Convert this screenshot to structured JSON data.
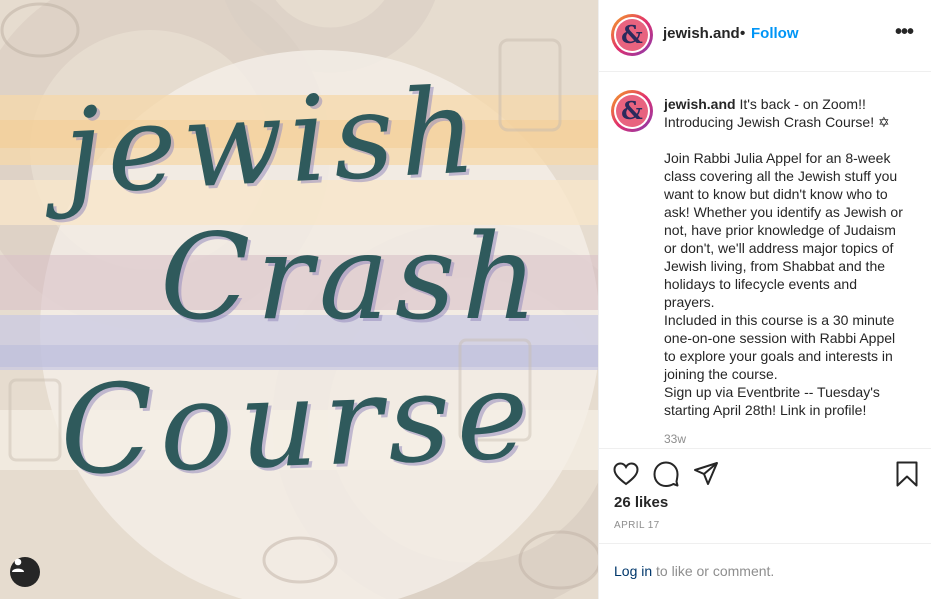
{
  "post": {
    "image": {
      "lettering": [
        "jewish",
        "Crash",
        "Course"
      ]
    },
    "header": {
      "username": "jewish.and",
      "separator": "•",
      "follow_label": "Follow",
      "more_icon": "more-options-icon",
      "avatar_monogram": "&"
    },
    "caption": {
      "username": "jewish.and",
      "lines": [
        "It's back - on Zoom!!",
        "Introducing Jewish Crash Course! ✡"
      ],
      "paragraph": [
        "Join Rabbi Julia Appel for an 8-week",
        "class covering all the Jewish stuff you",
        "want to know but didn't know who to",
        "ask! Whether you identify as Jewish or",
        "not, have prior knowledge of Judaism",
        "or don't, we'll address major topics of",
        "Jewish living, from Shabbat and the",
        "holidays to lifecycle events and",
        "prayers.",
        "Included in this course is a 30 minute",
        "one-on-one session with Rabbi Appel",
        "to explore your goals and interests in",
        "joining the course.",
        "Sign up via Eventbrite -- Tuesday's",
        "starting April 28th! Link in profile!"
      ],
      "age": "33w"
    },
    "actions": {
      "like_icon": "heart-icon",
      "comment_icon": "comment-icon",
      "share_icon": "share-icon",
      "save_icon": "bookmark-icon",
      "likes": "26 likes",
      "date": "APRIL 17"
    },
    "comment_prompt": {
      "login_label": "Log in",
      "rest": " to like or comment."
    }
  },
  "colors": {
    "accent_link": "#0095f6",
    "login_link": "#00376b",
    "lettering": "#2f5a5c",
    "muted_text": "#8e8e8e"
  }
}
